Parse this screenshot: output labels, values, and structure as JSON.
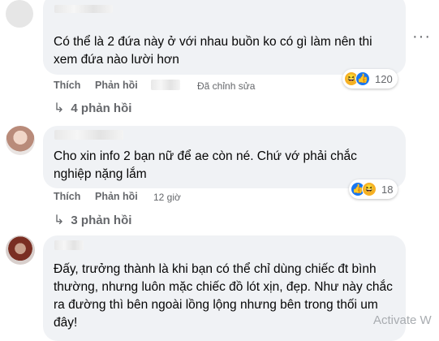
{
  "comments": [
    {
      "text": "Có thể là 2 đứa này ở với nhau buồn ko có gì làm nên thi xem đứa nào lười hơn",
      "like_label": "Thích",
      "reply_label": "Phản hồi",
      "status": "Đã chỉnh sửa",
      "reaction_count": "120",
      "replies_label": "4 phản hồi"
    },
    {
      "text": "Cho xin info 2 bạn nữ để ae còn né. Chứ vớ phải chắc nghiệp nặng lắm",
      "like_label": "Thích",
      "reply_label": "Phản hồi",
      "time": "12 giờ",
      "reaction_count": "18",
      "replies_label": "3 phản hồi"
    },
    {
      "text": "Đấy, trưởng thành là khi bạn có thể chỉ dùng chiếc đt bình thường, nhưng luôn mặc chiếc đồ lót xịn, đẹp. Như này chắc ra đường thì bên ngoài lồng lộng nhưng bên trong thối um đây!"
    }
  ],
  "icons": {
    "more": "more-options-icon",
    "reply_arrow": "reply-arrow-icon",
    "haha": "haha-reaction-icon",
    "like": "like-reaction-icon"
  },
  "colors": {
    "bubble": "#f0f2f5",
    "action_text": "#65676b",
    "like_blue": "#1877f2",
    "haha_yellow": "#f7b125"
  },
  "watermark": "Activate W"
}
